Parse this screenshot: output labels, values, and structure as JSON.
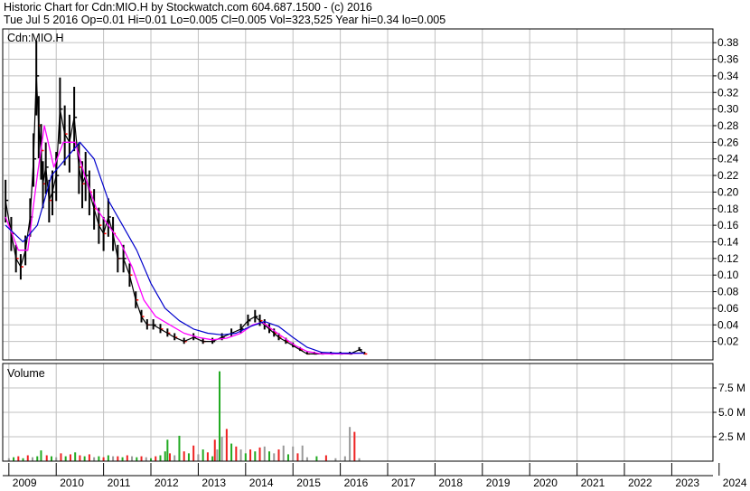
{
  "header": {
    "line1": "Historic Chart for Cdn:MIO.H by Stockwatch.com 604.687.1500 - (c) 2016",
    "line2": "Tue Jul  5 2016  Op=0.01  Hi=0.01  Lo=0.005  Cl=0.005  Vol=323,525  Year hi=0.34  lo=0.005"
  },
  "colors": {
    "price_bar": "#000000",
    "ma_short": "#ff00ff",
    "ma_long": "#0000cc",
    "close_down": "#ff0000",
    "volume_up": "#22aa22",
    "volume_down": "#ee2222",
    "volume_flat": "#999999",
    "grid": "#c0c0c0"
  },
  "chart_data": [
    {
      "type": "line",
      "title": "Cdn:MIO.H",
      "ylim": [
        0,
        0.39
      ],
      "y_ticks": [
        "0.02",
        "0.04",
        "0.06",
        "0.08",
        "0.10",
        "0.12",
        "0.14",
        "0.16",
        "0.18",
        "0.20",
        "0.22",
        "0.24",
        "0.26",
        "0.28",
        "0.30",
        "0.32",
        "0.34",
        "0.36",
        "0.38"
      ],
      "x_ticks": [
        "2009",
        "2010",
        "2011",
        "2012",
        "2013",
        "2014",
        "2015",
        "2016",
        "2017",
        "2018",
        "2019",
        "2020",
        "2021",
        "2022",
        "2023",
        "2024"
      ],
      "grid": true,
      "series": [
        {
          "kind": "price",
          "x": [
            2008.93,
            2009.05,
            2009.15,
            2009.25,
            2009.35,
            2009.45,
            2009.52,
            2009.58,
            2009.63,
            2009.68,
            2009.72,
            2009.78,
            2009.85,
            2009.92,
            2010.0,
            2010.08,
            2010.18,
            2010.28,
            2010.38,
            2010.48,
            2010.55,
            2010.62,
            2010.7,
            2010.8,
            2010.9,
            2011.0,
            2011.1,
            2011.2,
            2011.3,
            2011.42,
            2011.55,
            2011.68,
            2011.8,
            2011.92,
            2012.05,
            2012.2,
            2012.35,
            2012.5,
            2012.7,
            2012.9,
            2013.1,
            2013.3,
            2013.5,
            2013.7,
            2013.9,
            2014.05,
            2014.2,
            2014.3,
            2014.4,
            2014.5,
            2014.6,
            2014.7,
            2014.85,
            2015.0,
            2015.15,
            2015.3,
            2015.45,
            2015.6,
            2015.8,
            2016.0,
            2016.2,
            2016.4,
            2016.51
          ],
          "y": [
            0.19,
            0.15,
            0.12,
            0.11,
            0.13,
            0.17,
            0.24,
            0.34,
            0.28,
            0.25,
            0.21,
            0.23,
            0.19,
            0.2,
            0.22,
            0.3,
            0.27,
            0.26,
            0.29,
            0.23,
            0.21,
            0.22,
            0.2,
            0.18,
            0.16,
            0.15,
            0.17,
            0.15,
            0.12,
            0.12,
            0.1,
            0.07,
            0.05,
            0.04,
            0.04,
            0.035,
            0.03,
            0.025,
            0.02,
            0.025,
            0.02,
            0.02,
            0.025,
            0.03,
            0.035,
            0.045,
            0.05,
            0.045,
            0.04,
            0.035,
            0.03,
            0.025,
            0.02,
            0.015,
            0.01,
            0.005,
            0.005,
            0.005,
            0.005,
            0.005,
            0.005,
            0.01,
            0.005
          ]
        },
        {
          "kind": "moving-average-short",
          "x": [
            2008.93,
            2009.2,
            2009.4,
            2009.6,
            2009.75,
            2009.95,
            2010.15,
            2010.4,
            2010.6,
            2010.85,
            2011.1,
            2011.35,
            2011.6,
            2011.85,
            2012.1,
            2012.4,
            2012.7,
            2013.0,
            2013.3,
            2013.6,
            2013.9,
            2014.15,
            2014.35,
            2014.55,
            2014.8,
            2015.05,
            2015.3,
            2015.6,
            2016.0,
            2016.5
          ],
          "y": [
            0.17,
            0.13,
            0.13,
            0.22,
            0.28,
            0.23,
            0.26,
            0.26,
            0.22,
            0.18,
            0.16,
            0.14,
            0.11,
            0.07,
            0.05,
            0.04,
            0.03,
            0.025,
            0.022,
            0.024,
            0.03,
            0.04,
            0.043,
            0.035,
            0.025,
            0.015,
            0.008,
            0.005,
            0.005,
            0.006
          ]
        },
        {
          "kind": "moving-average-long",
          "x": [
            2008.93,
            2009.3,
            2009.6,
            2009.9,
            2010.2,
            2010.5,
            2010.8,
            2011.1,
            2011.4,
            2011.7,
            2012.0,
            2012.3,
            2012.6,
            2012.9,
            2013.2,
            2013.5,
            2013.8,
            2014.1,
            2014.4,
            2014.7,
            2015.0,
            2015.3,
            2015.6,
            2015.9,
            2016.2,
            2016.5
          ],
          "y": [
            0.16,
            0.14,
            0.16,
            0.22,
            0.24,
            0.26,
            0.24,
            0.19,
            0.16,
            0.13,
            0.09,
            0.06,
            0.045,
            0.035,
            0.03,
            0.028,
            0.03,
            0.038,
            0.044,
            0.038,
            0.025,
            0.013,
            0.007,
            0.006,
            0.006,
            0.006
          ]
        }
      ]
    },
    {
      "type": "bar",
      "title": "Volume",
      "ylim": [
        0,
        10
      ],
      "y_ticks": [
        "2.5 M",
        "5.0 M",
        "7.5 M"
      ],
      "grid": true,
      "series": [
        {
          "name": "Volume",
          "x": [
            2009.0,
            2009.1,
            2009.2,
            2009.3,
            2009.4,
            2009.5,
            2009.6,
            2009.68,
            2009.8,
            2009.9,
            2010.0,
            2010.1,
            2010.2,
            2010.3,
            2010.4,
            2010.5,
            2010.6,
            2010.7,
            2010.8,
            2010.9,
            2011.0,
            2011.1,
            2011.2,
            2011.3,
            2011.4,
            2011.5,
            2011.6,
            2011.7,
            2011.8,
            2011.9,
            2012.0,
            2012.1,
            2012.2,
            2012.3,
            2012.35,
            2012.4,
            2012.5,
            2012.6,
            2012.7,
            2012.8,
            2012.9,
            2013.0,
            2013.1,
            2013.2,
            2013.3,
            2013.35,
            2013.4,
            2013.45,
            2013.5,
            2013.6,
            2013.7,
            2013.8,
            2013.9,
            2014.0,
            2014.1,
            2014.2,
            2014.3,
            2014.4,
            2014.5,
            2014.6,
            2014.7,
            2014.8,
            2014.9,
            2015.0,
            2015.1,
            2015.2,
            2015.3,
            2015.5,
            2015.7,
            2015.9,
            2016.1,
            2016.2,
            2016.3,
            2016.4
          ],
          "values": [
            0.3,
            0.4,
            0.5,
            0.3,
            0.6,
            0.4,
            0.5,
            1.1,
            0.6,
            0.5,
            0.4,
            0.8,
            0.5,
            0.7,
            0.9,
            0.6,
            0.5,
            0.7,
            0.4,
            0.5,
            0.4,
            0.6,
            0.5,
            0.5,
            0.4,
            0.6,
            0.5,
            0.4,
            0.5,
            0.4,
            0.3,
            0.5,
            0.6,
            1.0,
            2.2,
            0.8,
            0.6,
            2.6,
            1.0,
            0.8,
            1.6,
            0.7,
            1.2,
            0.9,
            0.5,
            2.2,
            1.2,
            9.2,
            2.5,
            3.3,
            1.8,
            1.5,
            1.2,
            0.8,
            1.2,
            1.0,
            1.4,
            1.5,
            1.0,
            0.8,
            1.2,
            1.6,
            0.7,
            1.5,
            0.8,
            1.6,
            0.4,
            0.5,
            0.6,
            0.3,
            0.5,
            3.5,
            3.0,
            0.3
          ],
          "direction": [
            "flat",
            "up",
            "down",
            "up",
            "down",
            "flat",
            "up",
            "up",
            "down",
            "up",
            "flat",
            "down",
            "up",
            "down",
            "up",
            "down",
            "up",
            "down",
            "flat",
            "up",
            "down",
            "up",
            "flat",
            "down",
            "up",
            "down",
            "flat",
            "up",
            "down",
            "flat",
            "up",
            "down",
            "up",
            "up",
            "up",
            "down",
            "flat",
            "up",
            "down",
            "up",
            "down",
            "flat",
            "up",
            "down",
            "up",
            "down",
            "flat",
            "up",
            "flat",
            "down",
            "up",
            "down",
            "flat",
            "up",
            "down",
            "up",
            "down",
            "flat",
            "up",
            "flat",
            "down",
            "flat",
            "up",
            "flat",
            "down",
            "flat",
            "flat",
            "up",
            "down",
            "flat",
            "flat",
            "flat",
            "down",
            "flat"
          ]
        }
      ]
    }
  ]
}
